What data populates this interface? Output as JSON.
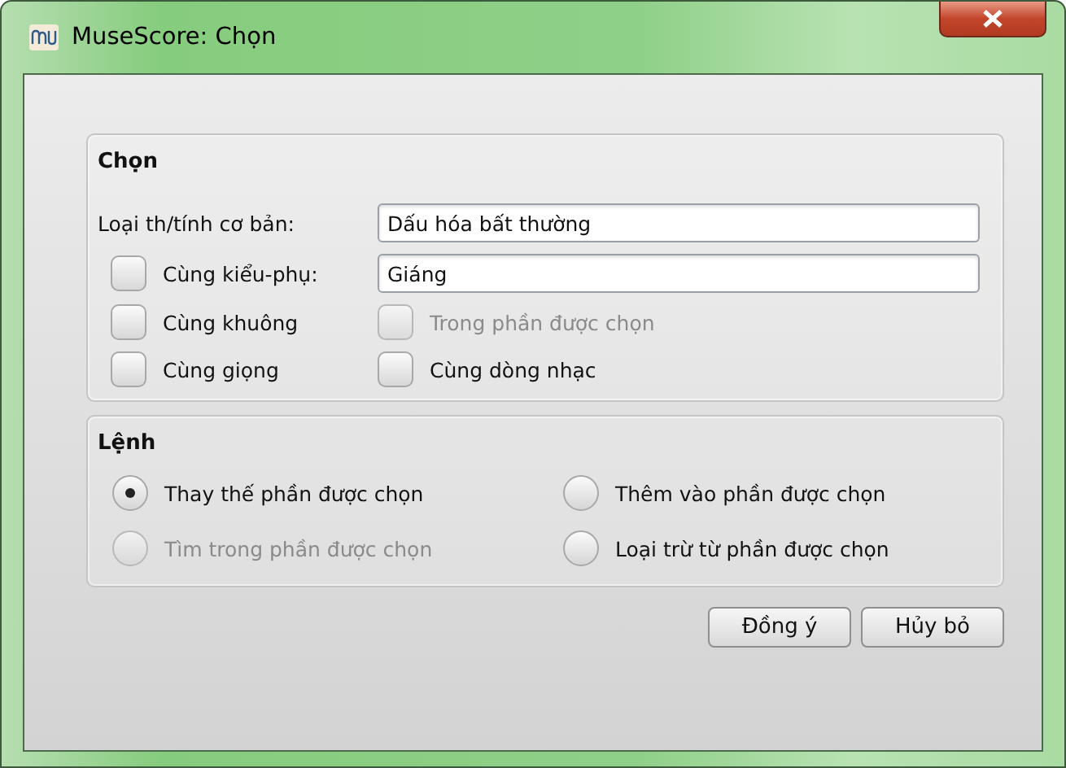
{
  "window": {
    "title": "MuseScore: Chọn"
  },
  "select_group": {
    "title": "Chọn",
    "base_type": {
      "label": "Loại th/tính cơ bản:",
      "value": "Dấu hóa bất thường"
    },
    "subtype": {
      "label": "Cùng kiểu-phụ:",
      "checked": false,
      "value": "Giáng"
    },
    "options": [
      {
        "label": "Cùng khuông",
        "checked": false,
        "disabled": false
      },
      {
        "label": "Trong phần được chọn",
        "checked": false,
        "disabled": true
      },
      {
        "label": "Cùng giọng",
        "checked": false,
        "disabled": false
      },
      {
        "label": "Cùng dòng nhạc",
        "checked": false,
        "disabled": false
      }
    ]
  },
  "command_group": {
    "title": "Lệnh",
    "options": [
      {
        "label": "Thay thế phần được chọn",
        "selected": true,
        "disabled": false
      },
      {
        "label": "Thêm vào phần được chọn",
        "selected": false,
        "disabled": false
      },
      {
        "label": "Tìm trong phần được chọn",
        "selected": false,
        "disabled": true
      },
      {
        "label": "Loại trừ từ phần được chọn",
        "selected": false,
        "disabled": false
      }
    ]
  },
  "buttons": [
    "Đồng ý",
    "Hủy bỏ"
  ]
}
